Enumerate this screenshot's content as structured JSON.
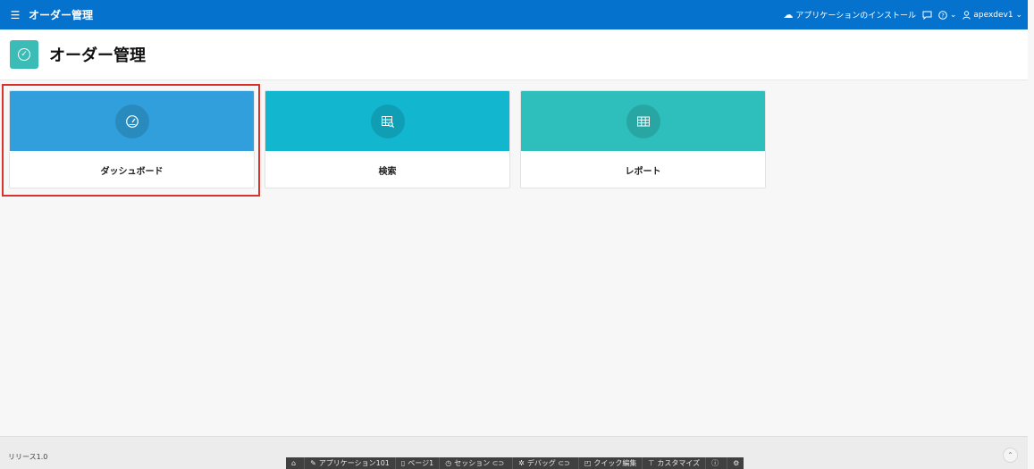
{
  "topbar": {
    "menu_icon": "hamburger-icon",
    "title": "オーダー管理",
    "install_label": "アプリケーションのインストール",
    "feedback_icon": "chat-bubble-icon",
    "help_icon": "help-circle-icon",
    "user_label": "apexdev1",
    "color": "#0572ce"
  },
  "hero": {
    "title": "オーダー管理",
    "badge_icon": "check-circle-icon",
    "badge_color": "#3bbcb6"
  },
  "cards": [
    {
      "label": "ダッシュボード",
      "icon": "gauge-icon",
      "color": "#309fdb",
      "selected": true
    },
    {
      "label": "検索",
      "icon": "table-search-icon",
      "color": "#13b6cf",
      "selected": false
    },
    {
      "label": "レポート",
      "icon": "table-icon",
      "color": "#2ebfbc",
      "selected": false
    }
  ],
  "footer": {
    "release": "リリース1.0",
    "scroll_top_icon": "chevron-up-icon"
  },
  "devbar": {
    "home_icon": "home-icon",
    "app": "アプリケーション101",
    "page": "ページ1",
    "session": "セッション",
    "debug": "デバッグ",
    "quick_edit": "クイック編集",
    "customize": "カスタマイズ",
    "info_icon": "info-icon",
    "settings_icon": "gear-icon"
  }
}
